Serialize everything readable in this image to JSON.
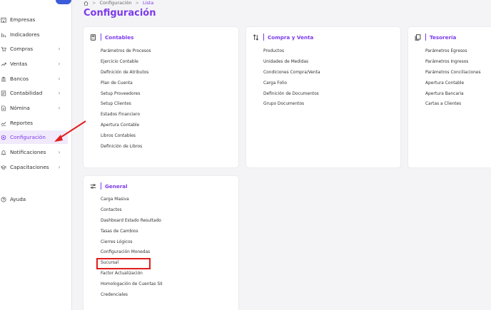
{
  "sidebar": {
    "items": [
      {
        "label": "Empresas",
        "icon": "building-icon",
        "chevron": false
      },
      {
        "label": "Indicadores",
        "icon": "bar-chart-icon",
        "chevron": false
      },
      {
        "label": "Compras",
        "icon": "cart-icon",
        "chevron": true
      },
      {
        "label": "Ventas",
        "icon": "trend-up-icon",
        "chevron": true
      },
      {
        "label": "Bancos",
        "icon": "bank-icon",
        "chevron": true
      },
      {
        "label": "Contabilidad",
        "icon": "ledger-icon",
        "chevron": true
      },
      {
        "label": "Nómina",
        "icon": "document-icon",
        "chevron": true
      },
      {
        "label": "Reportes",
        "icon": "line-chart-icon",
        "chevron": false
      },
      {
        "label": "Configuración",
        "icon": "gear-icon",
        "chevron": false,
        "active": true
      },
      {
        "label": "Notificaciones",
        "icon": "bell-icon",
        "chevron": true
      },
      {
        "label": "Capacitaciones",
        "icon": "graduation-icon",
        "chevron": true
      },
      {
        "label": "Ayuda",
        "icon": "help-icon",
        "chevron": false
      }
    ],
    "chevron_glyph": "›"
  },
  "breadcrumb": {
    "home_icon": "home-icon",
    "separator": ">",
    "section": "Configuración",
    "current": "Lista"
  },
  "page": {
    "title": "Configuración"
  },
  "cards": {
    "contables": {
      "title": "Contables",
      "icon": "calculator-icon",
      "links": [
        "Parámetros de Procesos",
        "Ejercicio Contable",
        "Definición de Atributos",
        "Plan de Cuenta",
        "Setup Proveedores",
        "Setup Clientes",
        "Estados Financiero",
        "Apertura Contable",
        "Libros Contables",
        "Definición de Libros"
      ]
    },
    "compra_venta": {
      "title": "Compra y Venta",
      "icon": "swap-vertical-icon",
      "links": [
        "Productos",
        "Unidades de Medidas",
        "Condiciones Compra/Venta",
        "Carga Folio",
        "Definición de Documentos",
        "Grupo Documentos"
      ]
    },
    "tesoreria": {
      "title": "Tesorería",
      "icon": "copy-icon",
      "links": [
        "Parámetros Egresos",
        "Parámetros Ingresos",
        "Parámetros Conciliaciones",
        "Apertura Contable",
        "Apertura Bancaria",
        "Cartas a Clientes"
      ]
    },
    "general": {
      "title": "General",
      "icon": "sliders-icon",
      "links": [
        "Carga Masiva",
        "Contactos",
        "Dashboard Estado Resultado",
        "Tasas de Cambios",
        "Cierres Lógicos",
        "Configuración Monedas",
        "Sucursal",
        "Factor Actualización",
        "Homologación de Cuentas SII",
        "Credenciales"
      ]
    }
  },
  "annotations": {
    "arrow_color": "#e11d1d",
    "highlight_color": "#e11d1d",
    "highlighted_link": "Sucursal"
  },
  "colors": {
    "accent": "#7c3aed",
    "active_bg": "#f1eafc",
    "page_bg": "#f4f4f6"
  }
}
